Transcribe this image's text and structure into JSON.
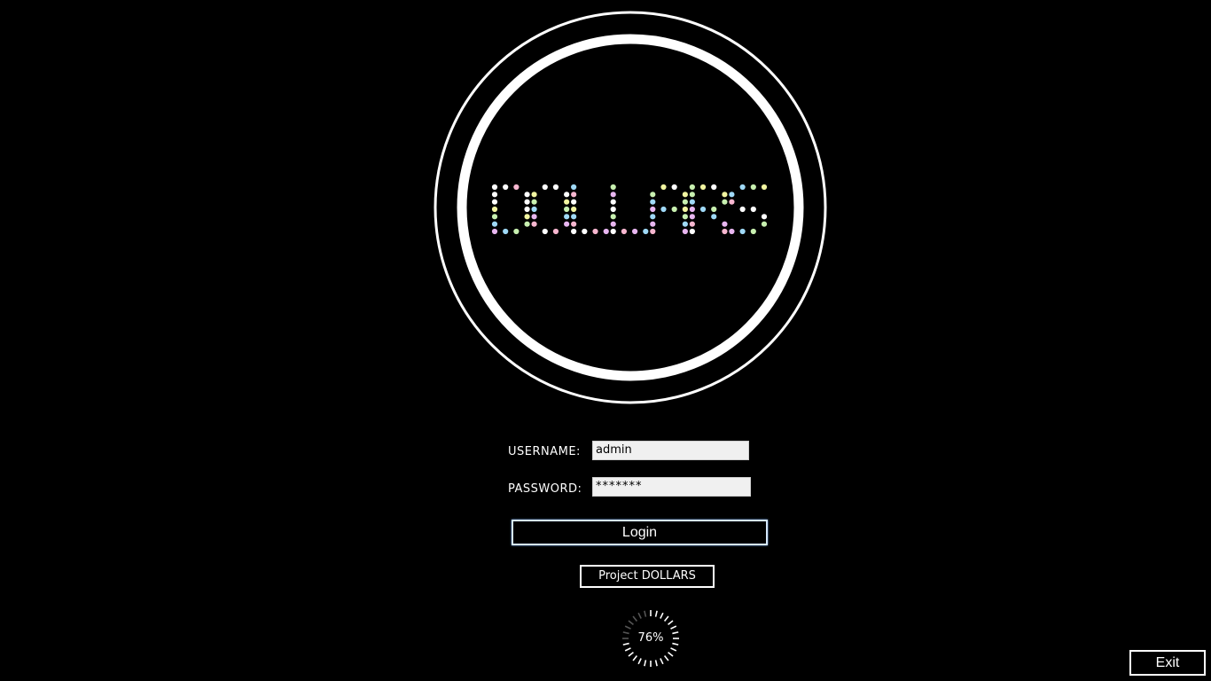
{
  "logo": {
    "text": "DOLLARS",
    "dot_colors": [
      "#ffffff",
      "#ffffff",
      "#f2f5a0",
      "#c8f0b0",
      "#9fd9f7",
      "#e8b6f0",
      "#f7b6cf",
      "#ffffff"
    ]
  },
  "form": {
    "username_label": "USERNAME:",
    "username_value": "admin",
    "password_label": "PASSWORD:",
    "password_value": "*******",
    "login_label": "Login"
  },
  "project_button_label": "Project DOLLARS",
  "progress": {
    "text": "76%",
    "value": 0.76
  },
  "exit_label": "Exit",
  "colors": {
    "background": "#000000",
    "ring": "#ffffff",
    "login_border": "#d6e9ff"
  }
}
